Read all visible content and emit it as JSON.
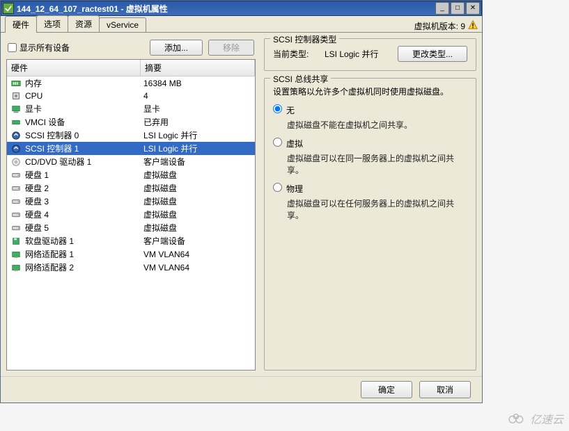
{
  "title": "144_12_64_107_ractest01  -  虚拟机属性",
  "tabs": [
    "硬件",
    "选项",
    "资源",
    "vService"
  ],
  "active_tab": 0,
  "vm_version_label": "虚拟机版本: 9",
  "show_all_label": "显示所有设备",
  "show_all_checked": false,
  "add_btn": "添加...",
  "remove_btn": "移除",
  "hw_headers": {
    "col1": "硬件",
    "col2": "摘要"
  },
  "hardware": [
    {
      "icon": "memory-icon",
      "name": "内存",
      "summary": "16384 MB",
      "sel": false
    },
    {
      "icon": "cpu-icon",
      "name": "CPU",
      "summary": "4",
      "sel": false
    },
    {
      "icon": "video-icon",
      "name": "显卡",
      "summary": "显卡",
      "sel": false
    },
    {
      "icon": "vmci-icon",
      "name": "VMCI 设备",
      "summary": "已弃用",
      "sel": false
    },
    {
      "icon": "scsi-icon",
      "name": "SCSI 控制器 0",
      "summary": "LSI Logic 并行",
      "sel": false
    },
    {
      "icon": "scsi-icon",
      "name": "SCSI 控制器 1",
      "summary": "LSI Logic 并行",
      "sel": true
    },
    {
      "icon": "cd-icon",
      "name": "CD/DVD 驱动器 1",
      "summary": "客户端设备",
      "sel": false
    },
    {
      "icon": "disk-icon",
      "name": "硬盘 1",
      "summary": "虚拟磁盘",
      "sel": false
    },
    {
      "icon": "disk-icon",
      "name": "硬盘 2",
      "summary": "虚拟磁盘",
      "sel": false
    },
    {
      "icon": "disk-icon",
      "name": "硬盘 3",
      "summary": "虚拟磁盘",
      "sel": false
    },
    {
      "icon": "disk-icon",
      "name": "硬盘 4",
      "summary": "虚拟磁盘",
      "sel": false
    },
    {
      "icon": "disk-icon",
      "name": "硬盘 5",
      "summary": "虚拟磁盘",
      "sel": false
    },
    {
      "icon": "floppy-icon",
      "name": "软盘驱动器 1",
      "summary": "客户端设备",
      "sel": false
    },
    {
      "icon": "nic-icon",
      "name": "网络适配器 1",
      "summary": "VM VLAN64",
      "sel": false
    },
    {
      "icon": "nic-icon",
      "name": "网络适配器 2",
      "summary": "VM VLAN64",
      "sel": false
    }
  ],
  "scsi_controller_type_group": "SCSI 控制器类型",
  "current_type_label": "当前类型:",
  "current_type_value": "LSI Logic 并行",
  "change_type_btn": "更改类型...",
  "bus_sharing_group": "SCSI 总线共享",
  "bus_sharing_hint": "设置策略以允许多个虚拟机同时使用虚拟磁盘。",
  "bus_options": [
    {
      "label": "无",
      "desc": "虚拟磁盘不能在虚拟机之间共享。",
      "checked": true
    },
    {
      "label": "虚拟",
      "desc": "虚拟磁盘可以在同一服务器上的虚拟机之间共享。",
      "checked": false
    },
    {
      "label": "物理",
      "desc": "虚拟磁盘可以在任何服务器上的虚拟机之间共享。",
      "checked": false
    }
  ],
  "ok_btn": "确定",
  "cancel_btn": "取消",
  "watermark": "亿速云"
}
